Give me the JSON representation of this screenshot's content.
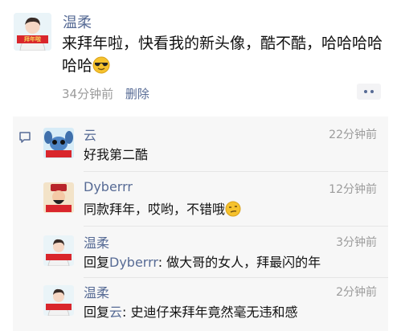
{
  "post": {
    "author": "温柔",
    "text": "来拜年啦，快看我的新头像，酷不酷，哈哈哈哈哈哈",
    "emoji": "sunglasses-emoji",
    "time": "34分钟前",
    "delete_label": "删除",
    "avatar_banner": "拜年啦"
  },
  "comments": [
    {
      "author": "云",
      "time": "22分钟前",
      "text": "好我第二酷",
      "avatar_banner": "拜年啦"
    },
    {
      "author": "Dyberrr",
      "time": "12分钟前",
      "text": "同款拜年，哎哟，不错哦",
      "emoji": "smirk-emoji",
      "avatar_banner": "拜年啦"
    },
    {
      "author": "温柔",
      "time": "3分钟前",
      "reply_prefix": "回复",
      "reply_to": "Dyberrr",
      "text": ": 做大哥的女人，拜最闪的年",
      "avatar_banner": "拜年啦"
    },
    {
      "author": "温柔",
      "time": "2分钟前",
      "reply_prefix": "回复",
      "reply_to": "云",
      "text": ": 史迪仔来拜年竟然毫无违和感",
      "avatar_banner": "拜年啦"
    }
  ],
  "colors": {
    "link": "#576b95",
    "meta": "#9b9b9b",
    "comments_bg": "#f7f7f7",
    "banner_red": "#d9262c"
  }
}
